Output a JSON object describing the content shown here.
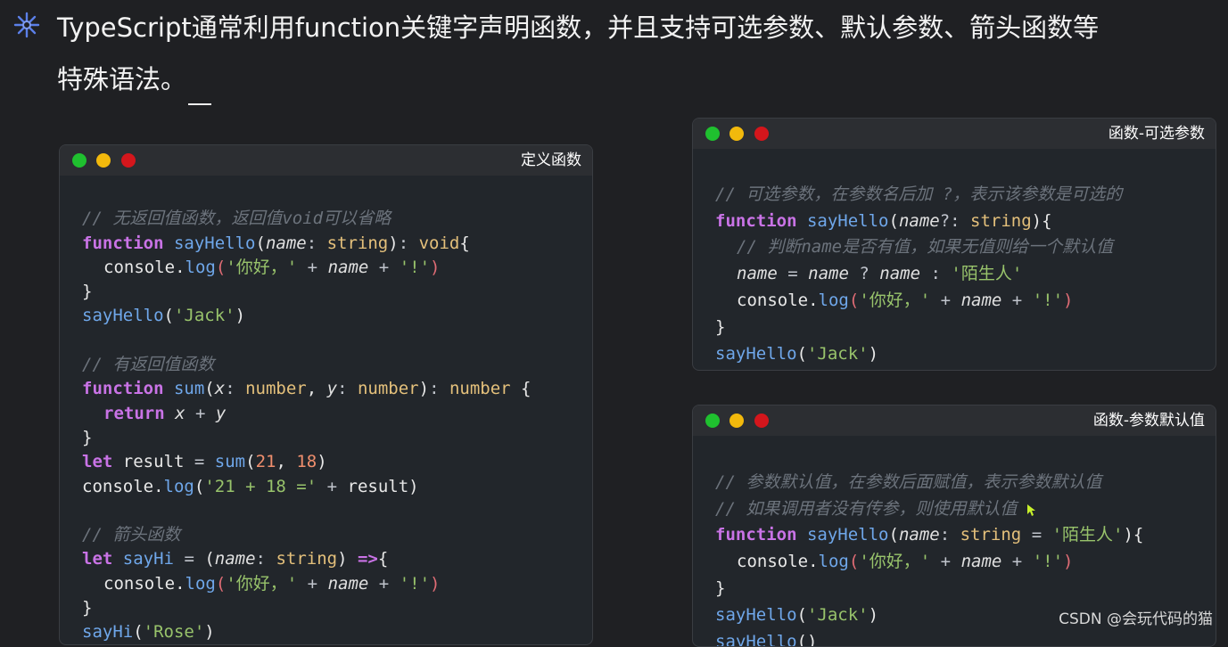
{
  "heading": {
    "icon": "sparkle-icon",
    "line1": "TypeScript通常利用function关键字声明函数，并且支持可选参数、默认参数、箭头函数等",
    "line2": "特殊语法。"
  },
  "colors": {
    "background": "#1f2023",
    "window_bg": "#22262b",
    "keyword": "#c973e6",
    "function": "#6fa7ea",
    "type": "#e4c07b",
    "string": "#98c36b",
    "comment": "#6c737c",
    "number": "#ef8e6d"
  },
  "windows": {
    "define": {
      "title": "定义函数",
      "c1": "// 无返回值函数，返回值void可以省略",
      "c2": "// 有返回值函数",
      "c3": "// 箭头函数",
      "kw_function": "function",
      "kw_return": "return",
      "kw_let": "let",
      "fn_sayHello": "sayHello",
      "fn_sum": "sum",
      "fn_sayHi": "sayHi",
      "p_name": "name",
      "p_x": "x",
      "p_y": "y",
      "t_string": "string",
      "t_void": "void",
      "t_number": "number",
      "console": "console",
      "log": "log",
      "s_hello": "'你好，'",
      "s_bang": "'!'",
      "s_jack": "'Jack'",
      "s_sum": "'21 + 18 ='",
      "s_rose": "'Rose'",
      "n21": "21",
      "n18": "18",
      "v_result": "result"
    },
    "optional": {
      "title": "函数-可选参数",
      "c1": "// 可选参数，在参数名后加 ?，表示该参数是可选的",
      "c2": "// 判断name是否有值，如果无值则给一个默认值",
      "kw_function": "function",
      "fn_sayHello": "sayHello",
      "p_name": "name",
      "t_string": "string",
      "console": "console",
      "log": "log",
      "s_stranger": "'陌生人'",
      "s_hello": "'你好，'",
      "s_bang": "'!'",
      "s_jack": "'Jack'"
    },
    "default": {
      "title": "函数-参数默认值",
      "c1": "// 参数默认值，在参数后面赋值，表示参数默认值",
      "c2": "// 如果调用者没有传参，则使用默认值",
      "kw_function": "function",
      "fn_sayHello": "sayHello",
      "p_name": "name",
      "t_string": "string",
      "console": "console",
      "log": "log",
      "s_stranger": "'陌生人'",
      "s_hello": "'你好，'",
      "s_bang": "'!'",
      "s_jack": "'Jack'"
    }
  },
  "watermark": "CSDN @会玩代码的猫"
}
